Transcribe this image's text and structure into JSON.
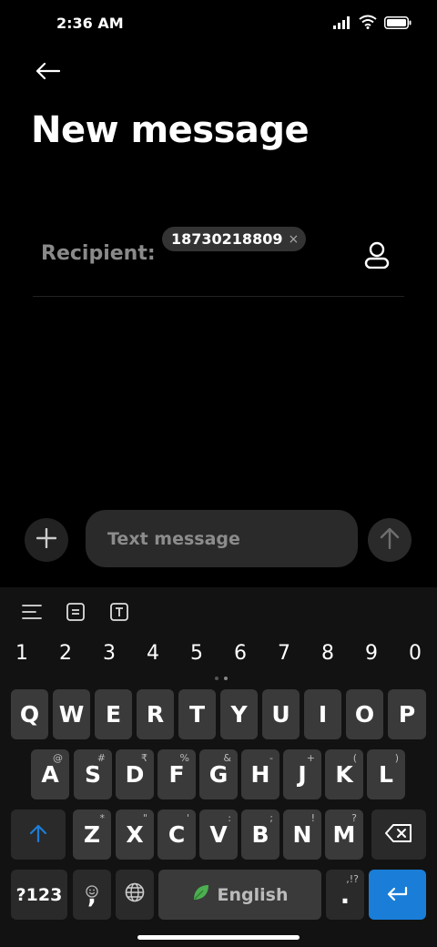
{
  "status_bar": {
    "time": "2:36 AM"
  },
  "header": {
    "back_icon": "arrow-left-icon",
    "title": "New message"
  },
  "recipient": {
    "label": "Recipient:",
    "chips": [
      {
        "text": "18730218809",
        "remove_label": "×"
      }
    ],
    "contacts_icon": "person-icon"
  },
  "compose": {
    "add_icon": "plus-icon",
    "placeholder": "Text message",
    "value": "",
    "send_icon": "arrow-up-icon"
  },
  "keyboard": {
    "toolbar_icons": [
      "menu-icon",
      "clipboard-icon",
      "text-format-icon"
    ],
    "number_row": [
      "1",
      "2",
      "3",
      "4",
      "5",
      "6",
      "7",
      "8",
      "9",
      "0"
    ],
    "row1": [
      {
        "key": "Q",
        "hint": ""
      },
      {
        "key": "W",
        "hint": ""
      },
      {
        "key": "E",
        "hint": ""
      },
      {
        "key": "R",
        "hint": ""
      },
      {
        "key": "T",
        "hint": ""
      },
      {
        "key": "Y",
        "hint": ""
      },
      {
        "key": "U",
        "hint": ""
      },
      {
        "key": "I",
        "hint": ""
      },
      {
        "key": "O",
        "hint": ""
      },
      {
        "key": "P",
        "hint": ""
      }
    ],
    "row2": [
      {
        "key": "A",
        "hint": "@"
      },
      {
        "key": "S",
        "hint": "#"
      },
      {
        "key": "D",
        "hint": "₹"
      },
      {
        "key": "F",
        "hint": "%"
      },
      {
        "key": "G",
        "hint": "&"
      },
      {
        "key": "H",
        "hint": "-"
      },
      {
        "key": "J",
        "hint": "+"
      },
      {
        "key": "K",
        "hint": "("
      },
      {
        "key": "L",
        "hint": ")"
      }
    ],
    "row3": [
      {
        "key": "Z",
        "hint": "*"
      },
      {
        "key": "X",
        "hint": "\""
      },
      {
        "key": "C",
        "hint": "'"
      },
      {
        "key": "V",
        "hint": ":"
      },
      {
        "key": "B",
        "hint": ";"
      },
      {
        "key": "N",
        "hint": "!"
      },
      {
        "key": "M",
        "hint": "?"
      }
    ],
    "shift_icon": "shift-arrow-icon",
    "backspace_icon": "backspace-icon",
    "symbols_label": "?123",
    "comma_label": ",",
    "emoji_icon": "smiley-icon",
    "globe_icon": "globe-icon",
    "space_label": "English",
    "space_icon": "leaf-icon",
    "period_label": ".",
    "period_hint": ",!?",
    "enter_icon": "enter-arrow-icon",
    "accent_color": "#1a7ed8",
    "shift_color": "#1a7ed8"
  }
}
